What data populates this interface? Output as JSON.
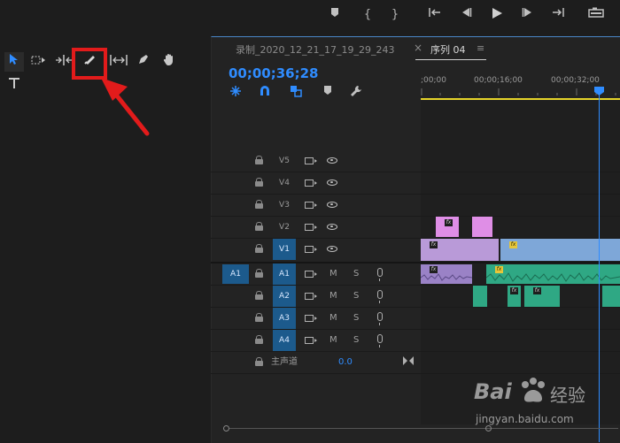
{
  "topbar": {
    "icons": [
      "marker-icon",
      "mark-in-icon",
      "mark-out-icon",
      "go-to-in-icon",
      "step-back-icon",
      "play-icon",
      "step-forward-icon",
      "go-to-out-icon",
      "camera-icon"
    ]
  },
  "tools": {
    "items": [
      "selection-tool",
      "track-select-tool",
      "ripple-edit-tool",
      "razor-tool",
      "slip-tool",
      "pen-tool",
      "hand-tool",
      "type-tool"
    ]
  },
  "tabs": {
    "source": "录制_2020_12_21_17_19_29_243",
    "close": "×",
    "sequence": "序列 04",
    "menu": "≡"
  },
  "timecode": "00;00;36;28",
  "ruler": {
    "labels": [
      ";00;00",
      "00;00;16;00",
      "00;00;32;00"
    ]
  },
  "tracks": {
    "video": [
      {
        "name": "V5"
      },
      {
        "name": "V4"
      },
      {
        "name": "V3"
      },
      {
        "name": "V2"
      },
      {
        "name": "V1"
      }
    ],
    "audio": [
      {
        "name": "A1",
        "m": "M",
        "s": "S",
        "source": "A1"
      },
      {
        "name": "A2",
        "m": "M",
        "s": "S"
      },
      {
        "name": "A3",
        "m": "M",
        "s": "S"
      },
      {
        "name": "A4",
        "m": "M",
        "s": "S"
      }
    ],
    "master": {
      "label": "主声道",
      "value": "0.0"
    }
  },
  "clips": {
    "fx_label": "fx"
  },
  "watermark": {
    "brand": "Bai",
    "brand2": "经验",
    "url": "jingyan.baidu.com"
  },
  "colors": {
    "accent": "#2f8cff",
    "video_clip": "#b99ad8",
    "v2_clip": "#df8ee6",
    "audio_clip": "#2fa884",
    "highlight": "#e21b1b",
    "in_out_bar": "#e7d52a"
  }
}
